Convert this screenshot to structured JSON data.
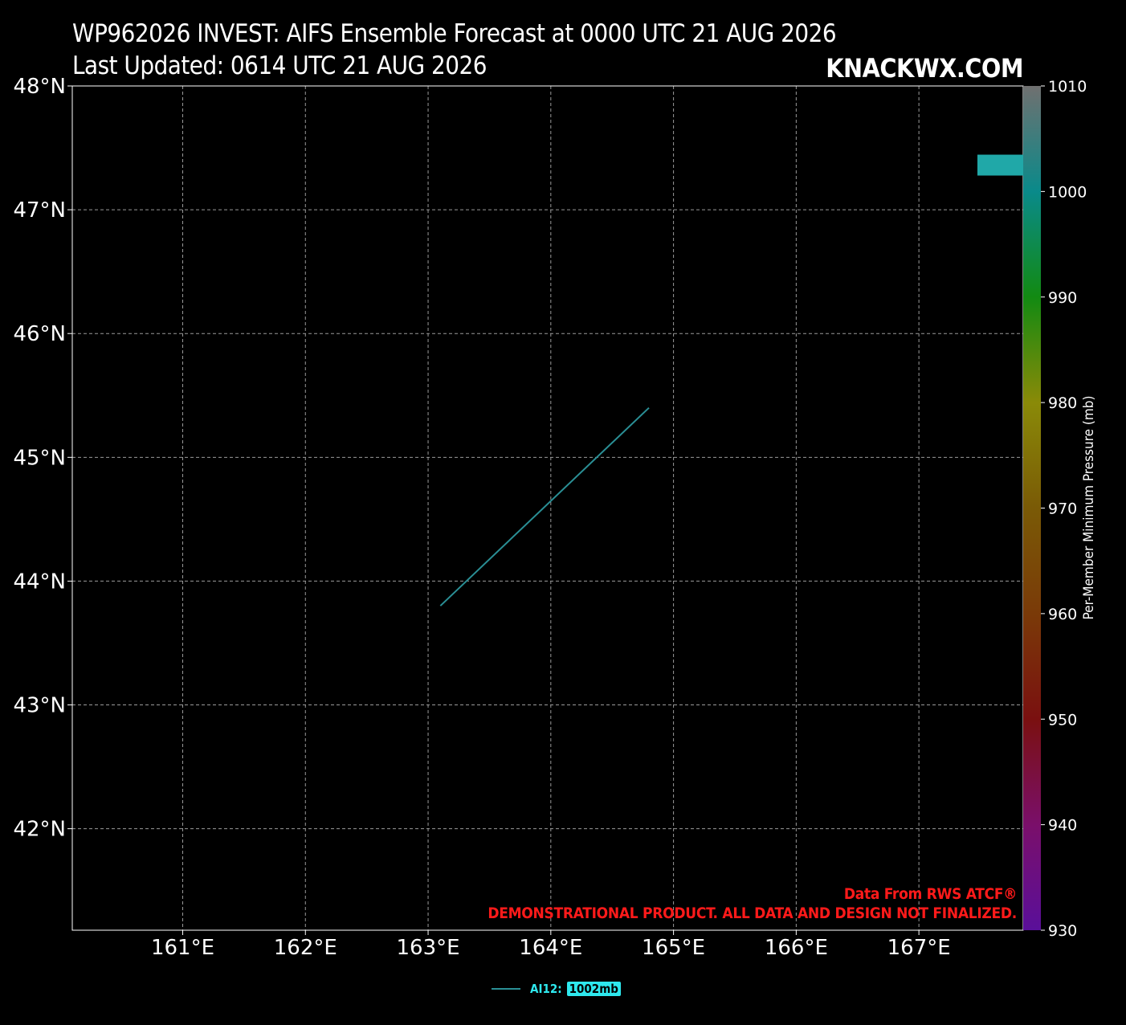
{
  "header": {
    "title_line1": "WP962026 INVEST: AIFS Ensemble Forecast at 0000 UTC 21 AUG 2026",
    "title_line2": "Last Updated: 0614 UTC 21 AUG 2026",
    "brand": "KNACKWX.COM"
  },
  "credits": {
    "line1": "Data From RWS ATCF®",
    "line2": "DEMONSTRATIONAL PRODUCT. ALL DATA AND DESIGN NOT FINALIZED."
  },
  "colors": {
    "background": "#000000",
    "track": "#2a8f95",
    "legend_badge": "#2ee8ee",
    "credit": "#ff1a1a"
  },
  "chart_data": {
    "type": "line",
    "xlim": [
      160.1,
      167.85
    ],
    "ylim": [
      41.18,
      48.0
    ],
    "x_ticks": [
      "161°E",
      "162°E",
      "163°E",
      "164°E",
      "165°E",
      "166°E",
      "167°E"
    ],
    "x_tick_values": [
      161,
      162,
      163,
      164,
      165,
      166,
      167
    ],
    "y_ticks": [
      "42°N",
      "43°N",
      "44°N",
      "45°N",
      "46°N",
      "47°N",
      "48°N"
    ],
    "y_tick_values": [
      42,
      43,
      44,
      45,
      46,
      47,
      48
    ],
    "grid": true,
    "series": [
      {
        "name": "AI12",
        "pressure_label": "1002mb",
        "pressure": 1002,
        "points": [
          [
            163.1,
            43.8
          ],
          [
            164.8,
            45.4
          ]
        ]
      }
    ],
    "legend": {
      "placement": "bottom-center",
      "entries": [
        {
          "label": "AI12:",
          "badge": "1002mb"
        }
      ]
    },
    "colorbar": {
      "label": "Per-Member Minimum Pressure (mb)",
      "min": 930,
      "max": 1010,
      "ticks": [
        "930",
        "940",
        "950",
        "960",
        "970",
        "980",
        "990",
        "1000",
        "1010"
      ],
      "tick_values": [
        930,
        940,
        950,
        960,
        970,
        980,
        990,
        1000,
        1010
      ],
      "marker_value": 1002.5,
      "marker_color": "#20a8a8"
    }
  }
}
